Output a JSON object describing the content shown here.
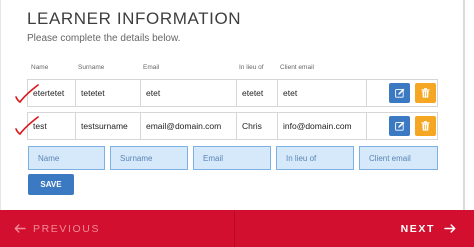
{
  "page": {
    "title": "LEARNER INFORMATION",
    "subtitle": "Please complete the details below."
  },
  "table": {
    "columns": [
      "Name",
      "Surname",
      "Email",
      "In lieu of",
      "Client email"
    ],
    "rows": [
      [
        "etertetet",
        "tetetet",
        "etet",
        "etetet",
        "etet"
      ],
      [
        "test",
        "testsurname",
        "email@domain.com",
        "Chris",
        "info@domain.com"
      ]
    ]
  },
  "form": {
    "name_placeholder": "Name",
    "surname_placeholder": "Surname",
    "email_placeholder": "Email",
    "in_lieu_placeholder": "In lieu of",
    "client_email_placeholder": "Client email",
    "save_label": "SAVE"
  },
  "footer": {
    "previous_label": "PREVIOUS",
    "next_label": "NEXT"
  },
  "colors": {
    "accent_blue": "#3b79c3",
    "delete_orange": "#f5a623",
    "footer_red": "#d20f2e",
    "input_bg": "#d6e9fb",
    "check_mark_red": "#d9161b"
  },
  "icons": {
    "edit": "pencil-square-icon",
    "delete": "trash-icon",
    "previous": "arrow-left-icon",
    "next": "arrow-right-icon",
    "row_mark": "handwritten-check-icon"
  }
}
